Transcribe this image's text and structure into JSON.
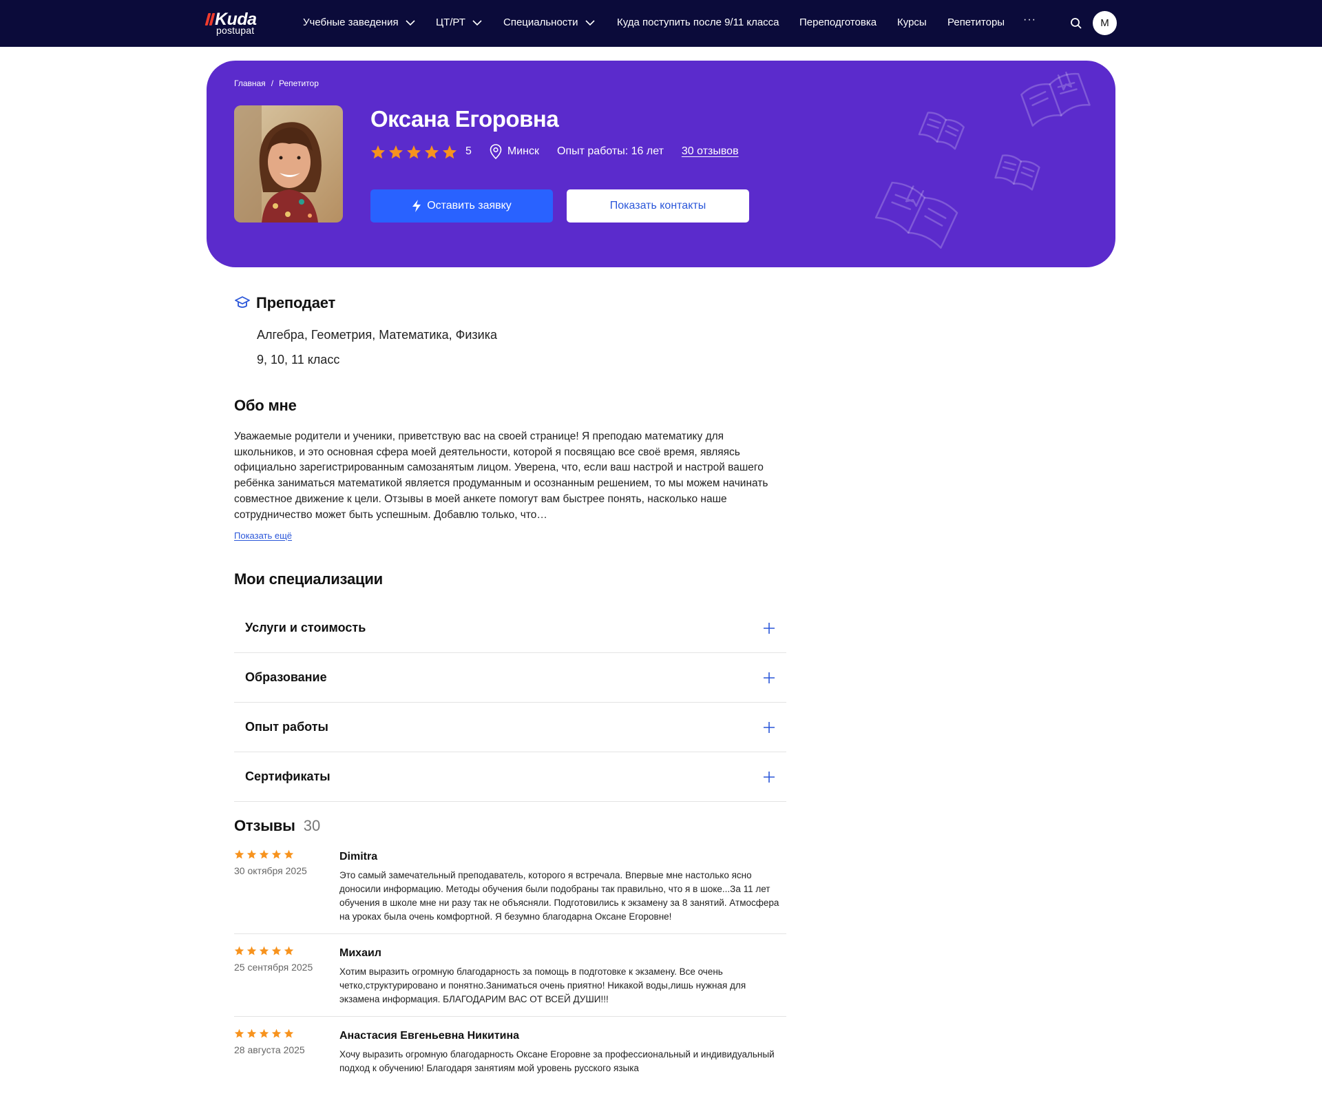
{
  "nav": {
    "logo_word": "Kuda",
    "logo_sub": "postupat",
    "items": [
      {
        "label": "Учебные заведения",
        "has_dropdown": true
      },
      {
        "label": "ЦТ/РТ",
        "has_dropdown": true
      },
      {
        "label": "Специальности",
        "has_dropdown": true
      },
      {
        "label": "Куда поступить после 9/11 класса",
        "has_dropdown": false
      },
      {
        "label": "Переподготовка",
        "has_dropdown": false
      },
      {
        "label": "Курсы",
        "has_dropdown": false
      },
      {
        "label": "Репетиторы",
        "has_dropdown": false
      }
    ],
    "more_label": "···",
    "avatar_initial": "M",
    "search_icon": "search-icon"
  },
  "breadcrumb": {
    "home": "Главная",
    "separator": "/",
    "current": "Репетитор"
  },
  "tutor": {
    "name": "Оксана Егоровна",
    "rating": "5",
    "rating_stars": 5,
    "city": "Минск",
    "experience": "Опыт работы: 16 лет",
    "reviews_link": "30 отзывов",
    "apply_button": "Оставить заявку",
    "contacts_button": "Показать контакты"
  },
  "teaches": {
    "title": "Преподает",
    "subjects": "Алгебра, Геометрия, Математика, Физика",
    "grades": "9, 10, 11 класс"
  },
  "about": {
    "title": "Обо мне",
    "text": "Уважаемые родители и ученики, приветствую вас на своей странице! Я преподаю математику для школьников, и это основная сфера моей деятельности, которой я посвящаю все своё время, являясь официально зарегистрированным самозанятым лицом. Уверена, что, если ваш настрой и настрой вашего ребёнка заниматься математикой является продуманным и осознанным решением, то мы можем начинать совместное движение к цели. Отзывы в моей анкете помогут вам быстрее понять, насколько наше сотрудничество может быть успешным. Добавлю только, что…",
    "show_more": "Показать ещё"
  },
  "specializations": {
    "title": "Мои специализации",
    "items": [
      "Услуги и стоимость",
      "Образование",
      "Опыт работы",
      "Сертификаты"
    ]
  },
  "reviews": {
    "title": "Отзывы",
    "count": "30",
    "items": [
      {
        "stars": 5,
        "date": "30 октября 2025",
        "author": "Dimitra",
        "text": "Это самый замечательный преподаватель, которого я встречала. Впервые мне настолько ясно доносили информацию. Методы обучения были подобраны так правильно, что я в шоке...За 11 лет обучения в школе мне ни разу так не объясняли. Подготовились к экзамену за 8 занятий. Атмосфера на уроках была очень комфортной. Я безумно благодарна Оксане Егоровне!"
      },
      {
        "stars": 5,
        "date": "25 сентября 2025",
        "author": "Михаил",
        "text": "Хотим выразить огромную благодарность за помощь в подготовке к экзамену. Все очень четко,структурировано и понятно.Заниматься очень приятно! Никакой воды,лишь нужная для экзамена информация. БЛАГОДАРИМ ВАС ОТ ВСЕЙ ДУШИ!!!"
      },
      {
        "stars": 5,
        "date": "28 августа 2025",
        "author": "Анастасия Евгеньевна Никитина",
        "text": "Хочу выразить огромную благодарность Оксане Егоровне за профессиональный и индивидуальный подход к обучению! Благодаря занятиям мой уровень русского языка"
      }
    ]
  },
  "colors": {
    "navbar": "#0b0b3a",
    "hero": "#5b2bcc",
    "primary_button": "#2962ff",
    "link": "#2a56d9",
    "star": "#f7931e",
    "logo_red": "#ef3b2d"
  }
}
